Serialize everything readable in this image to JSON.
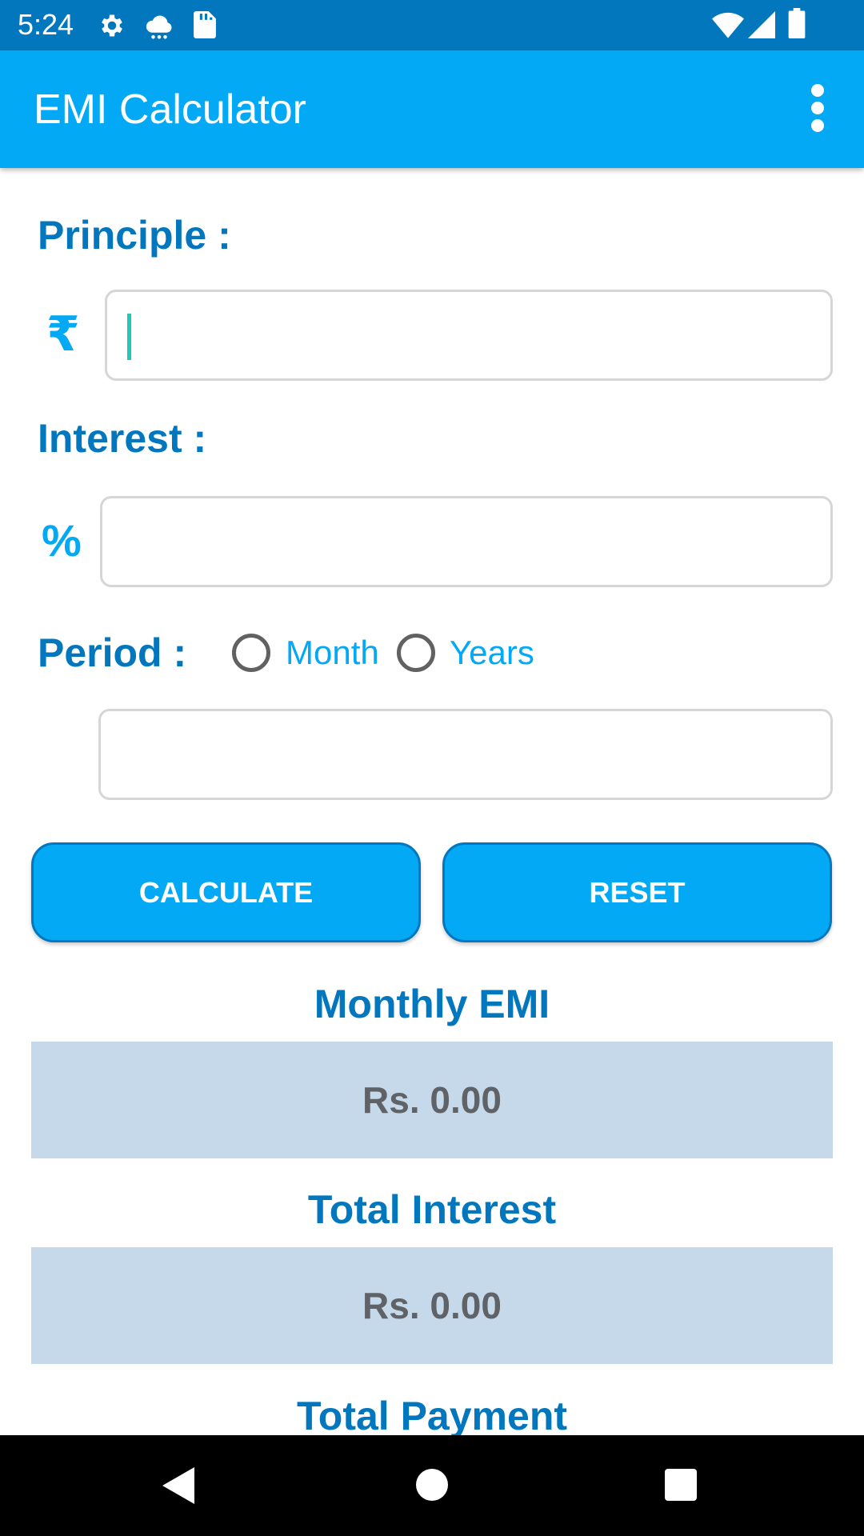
{
  "status_bar": {
    "time": "5:24",
    "left_icons": [
      "gear-icon",
      "weather-icon",
      "sd-card-icon"
    ],
    "right_icons": [
      "wifi-icon",
      "signal-icon",
      "battery-icon"
    ]
  },
  "app_bar": {
    "title": "EMI Calculator",
    "menu_icon": "more-vert-icon",
    "color": "#03a9f4"
  },
  "form": {
    "principle_label": "Principle :",
    "principle_symbol": "₹",
    "principle_value": "",
    "interest_label": "Interest :",
    "interest_symbol": "%",
    "interest_value": "",
    "period_label": "Period :",
    "period_options": [
      {
        "label": "Month",
        "selected": false
      },
      {
        "label": "Years",
        "selected": false
      }
    ],
    "period_value": ""
  },
  "buttons": {
    "calculate_label": "CALCULATE",
    "reset_label": "RESET"
  },
  "results": {
    "monthly_emi_title": "Monthly EMI",
    "monthly_emi_value": "Rs. 0.00",
    "total_interest_title": "Total Interest",
    "total_interest_value": "Rs. 0.00",
    "total_payment_title": "Total Payment"
  },
  "nav_bar": {
    "icons": [
      "back-icon",
      "home-icon",
      "recents-icon"
    ]
  },
  "colors": {
    "primary": "#03a9f4",
    "primary_dark": "#0277bd",
    "result_bg": "#c5d9ea"
  }
}
